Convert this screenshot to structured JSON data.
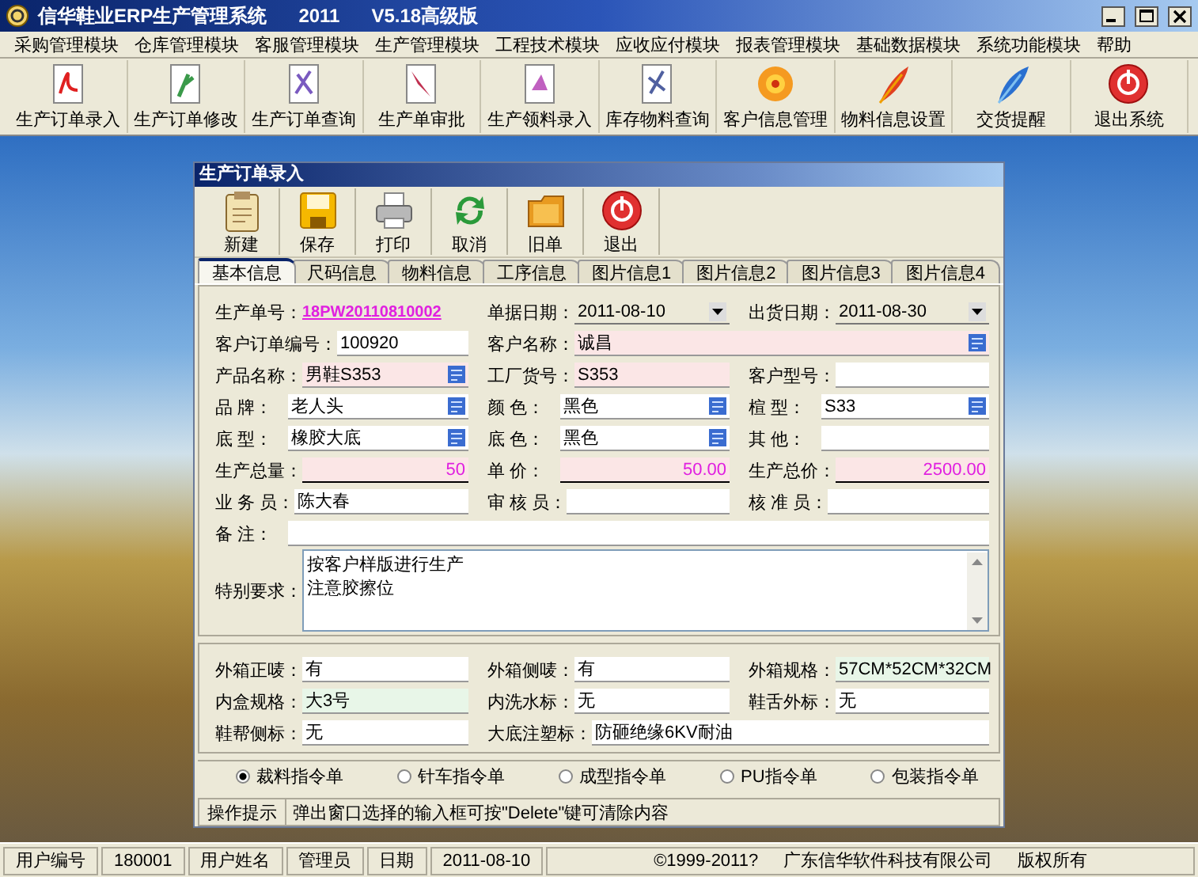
{
  "window": {
    "title": "信华鞋业ERP生产管理系统",
    "year": "2011",
    "version": "V5.18高级版"
  },
  "menu": [
    "采购管理模块",
    "仓库管理模块",
    "客服管理模块",
    "生产管理模块",
    "工程技术模块",
    "应收应付模块",
    "报表管理模块",
    "基础数据模块",
    "系统功能模块",
    "帮助"
  ],
  "toolbar": [
    "生产订单录入",
    "生产订单修改",
    "生产订单查询",
    "生产单审批",
    "生产领料录入",
    "库存物料查询",
    "客户信息管理",
    "物料信息设置",
    "交货提醒",
    "退出系统"
  ],
  "form_window": {
    "title": "生产订单录入",
    "toolbar": [
      "新建",
      "保存",
      "打印",
      "取消",
      "旧单",
      "退出"
    ],
    "tabs": [
      {
        "label": "基本信息",
        "selected": true
      },
      {
        "label": "尺码信息",
        "selected": false
      },
      {
        "label": "物料信息",
        "selected": false
      },
      {
        "label": "工序信息",
        "selected": false
      },
      {
        "label": "图片信息1",
        "selected": false
      },
      {
        "label": "图片信息2",
        "selected": false
      },
      {
        "label": "图片信息3",
        "selected": false
      },
      {
        "label": "图片信息4",
        "selected": false
      }
    ],
    "rows": [
      [
        {
          "label": "生产单号：",
          "value": "18PW20110810002",
          "kind": "link"
        },
        {
          "label": "单据日期：",
          "value": "2011-08-10",
          "kind": "date"
        },
        {
          "label": "出货日期：",
          "value": "2011-08-30",
          "kind": "date"
        }
      ],
      [
        {
          "label": "客户订单编号：",
          "value": "100920",
          "kind": "text"
        },
        {
          "label": "客户名称：",
          "value": "诚昌",
          "kind": "lookup",
          "color": "#fbe6e6"
        }
      ],
      [
        {
          "label": "产品名称：",
          "value": "男鞋S353",
          "kind": "lookup",
          "color": "#fbe6e6"
        },
        {
          "label": "工厂货号：",
          "value": "S353",
          "kind": "text",
          "color": "#fbe6e6"
        },
        {
          "label": "客户型号：",
          "kind": "text"
        }
      ],
      [
        {
          "label": "品 牌：",
          "value": "老人头",
          "kind": "lookup"
        },
        {
          "label": "颜 色：",
          "value": "黑色",
          "kind": "lookup"
        },
        {
          "label": "楦 型：",
          "value": "S33",
          "kind": "lookup"
        }
      ],
      [
        {
          "label": "底 型：",
          "value": "橡胶大底",
          "kind": "lookup"
        },
        {
          "label": "底 色：",
          "value": "黑色",
          "kind": "lookup"
        },
        {
          "label": "其 他：",
          "kind": "text"
        }
      ],
      [
        {
          "label": "生产总量：",
          "value": "50",
          "kind": "amount",
          "color": "#fbe6e6"
        },
        {
          "label": "单 价：",
          "value": "50.00",
          "kind": "amount",
          "color": "#fbe6e6"
        },
        {
          "label": "生产总价：",
          "value": "2500.00",
          "kind": "amount",
          "color": "#fbe6e6"
        }
      ],
      [
        {
          "label": "业 务 员：",
          "value": "陈大春",
          "kind": "text"
        },
        {
          "label": "审 核 员：",
          "kind": "text"
        },
        {
          "label": "核 准 员：",
          "kind": "text"
        }
      ],
      [
        {
          "label": "备 注：",
          "kind": "text"
        }
      ],
      [
        {
          "label": "特别要求：",
          "lines": [
            "按客户样版进行生产",
            "注意胶擦位"
          ],
          "kind": "memo"
        }
      ]
    ],
    "packing": [
      [
        {
          "label": "外箱正唛：",
          "value": "有",
          "kind": "text"
        },
        {
          "label": "外箱侧唛：",
          "value": "有",
          "kind": "text"
        },
        {
          "label": "外箱规格：",
          "value": "57CM*52CM*32CM",
          "kind": "text",
          "color": "#e8f6e8"
        }
      ],
      [
        {
          "label": "内盒规格：",
          "value": "大3号",
          "kind": "text",
          "color": "#e8f6e8"
        },
        {
          "label": "内洗水标：",
          "value": "无",
          "kind": "text"
        },
        {
          "label": "鞋舌外标：",
          "value": "无",
          "kind": "text"
        }
      ],
      [
        {
          "label": "鞋帮侧标：",
          "value": "无",
          "kind": "text"
        },
        {
          "label": "大底注塑标：",
          "value": "防砸绝缘6KV耐油",
          "kind": "text"
        }
      ]
    ],
    "order_types": [
      {
        "label": "裁料指令单",
        "selected": true
      },
      {
        "label": "针车指令单",
        "selected": false
      },
      {
        "label": "成型指令单",
        "selected": false
      },
      {
        "label": "PU指令单",
        "selected": false
      },
      {
        "label": "包装指令单",
        "selected": false
      }
    ],
    "hint": {
      "label": "操作提示",
      "text": "弹出窗口选择的输入框可按\"Delete\"键可清除内容"
    }
  },
  "status_bar": {
    "cells": [
      "用户编号",
      "180001",
      "用户姓名",
      "管理员",
      "日期",
      "2011-08-10"
    ],
    "copyright": [
      "©1999-2011?",
      "广东信华软件科技有限公司",
      "版权所有"
    ]
  }
}
